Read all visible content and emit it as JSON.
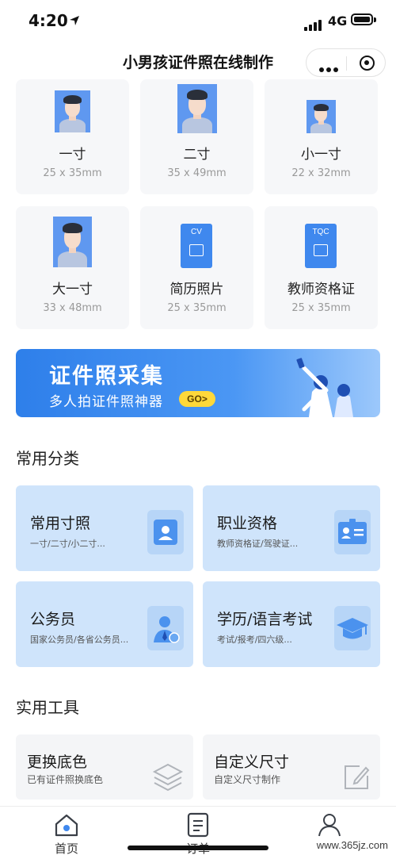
{
  "status_bar": {
    "time": "4:20",
    "network": "4G"
  },
  "nav": {
    "title": "小男孩证件照在线制作"
  },
  "sizes": [
    {
      "name": "一寸",
      "dims": "25 x 35mm",
      "icon": "portrait-photo-icon"
    },
    {
      "name": "二寸",
      "dims": "35 x 49mm",
      "icon": "portrait-photo-icon"
    },
    {
      "name": "小一寸",
      "dims": "22 x 32mm",
      "icon": "portrait-photo-icon"
    },
    {
      "name": "大一寸",
      "dims": "33 x 48mm",
      "icon": "portrait-photo-icon"
    },
    {
      "name": "简历照片",
      "dims": "25 x 35mm",
      "icon": "cv-document-icon",
      "icon_label": "CV"
    },
    {
      "name": "教师资格证",
      "dims": "25 x 35mm",
      "icon": "tqc-document-icon",
      "icon_label": "TQC"
    }
  ],
  "banner": {
    "title": "证件照采集",
    "subtitle": "多人拍证件照神器",
    "go_label": "GO>"
  },
  "categories_section": {
    "title": "常用分类",
    "items": [
      {
        "title": "常用寸照",
        "desc": "一寸/二寸/小二寸...",
        "icon": "portrait-icon"
      },
      {
        "title": "职业资格",
        "desc": "教师资格证/驾驶证...",
        "icon": "id-card-icon"
      },
      {
        "title": "公务员",
        "desc": "国家公务员/各省公务员...",
        "icon": "civil-servant-icon"
      },
      {
        "title": "学历/语言考试",
        "desc": "考试/报考/四六级...",
        "icon": "graduation-cap-icon"
      }
    ]
  },
  "tools_section": {
    "title": "实用工具",
    "items": [
      {
        "title": "更换底色",
        "desc": "已有证件照换底色",
        "icon": "layers-icon"
      },
      {
        "title": "自定义尺寸",
        "desc": "自定义尺寸制作",
        "icon": "edit-icon"
      }
    ]
  },
  "tabbar": {
    "items": [
      {
        "label": "首页"
      },
      {
        "label": "订单"
      },
      {
        "label": ""
      }
    ]
  },
  "watermark": "www.365jz.com",
  "colors": {
    "accent": "#3f88ee",
    "card_blue": "#cfe4fb",
    "card_gray": "#f6f7f9"
  }
}
